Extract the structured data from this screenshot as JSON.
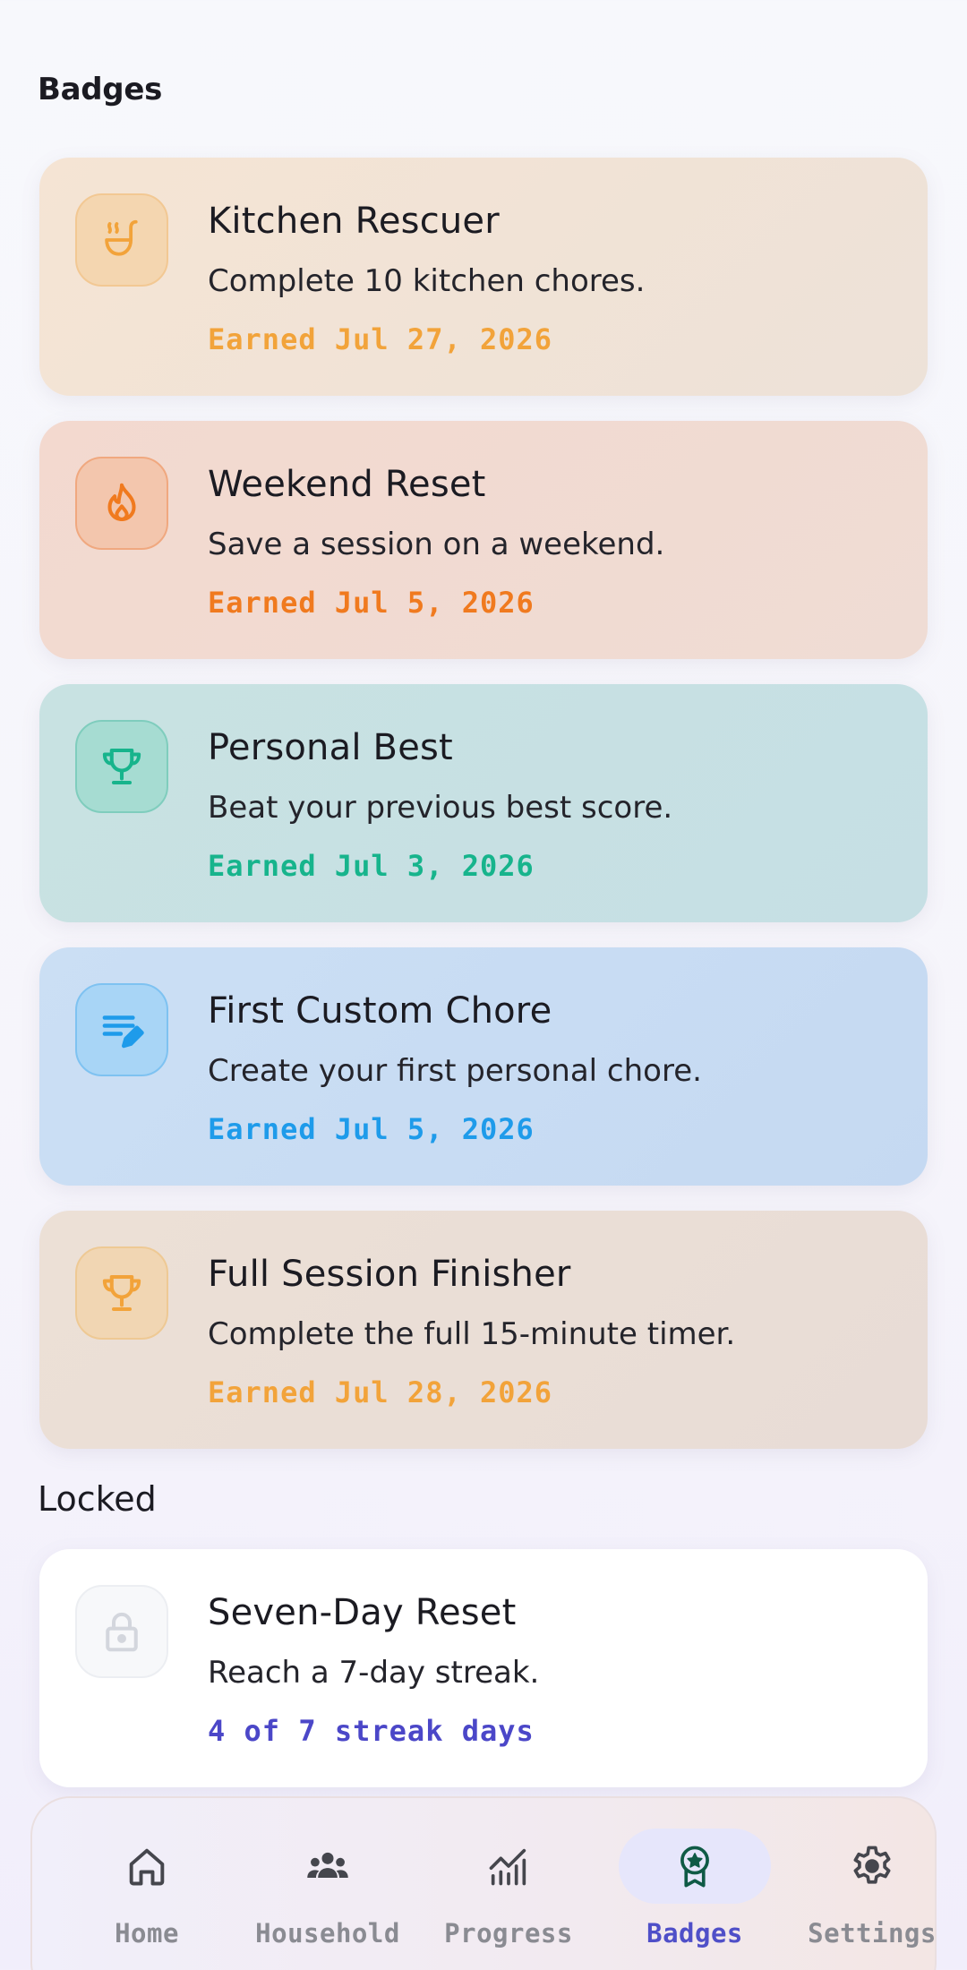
{
  "page": {
    "title": "Badges"
  },
  "earned": [
    {
      "title": "Kitchen Rescuer",
      "description": "Complete 10 kitchen chores.",
      "meta": "Earned Jul 27, 2026",
      "icon": "ladle-steam-icon",
      "accent": "#f2a33a"
    },
    {
      "title": "Weekend Reset",
      "description": "Save a session on a weekend.",
      "meta": "Earned Jul 5, 2026",
      "icon": "flame-icon",
      "accent": "#f07a1f"
    },
    {
      "title": "Personal Best",
      "description": "Beat your previous best score.",
      "meta": "Earned Jul 3, 2026",
      "icon": "trophy-icon",
      "accent": "#17b48c"
    },
    {
      "title": "First Custom Chore",
      "description": "Create your first personal chore.",
      "meta": "Earned Jul 5, 2026",
      "icon": "edit-list-icon",
      "accent": "#1e9bea"
    },
    {
      "title": "Full Session Finisher",
      "description": "Complete the full 15-minute timer.",
      "meta": "Earned Jul 28, 2026",
      "icon": "trophy-icon",
      "accent": "#f2a33a"
    }
  ],
  "locked_section": {
    "title": "Locked"
  },
  "locked": [
    {
      "title": "Seven-Day Reset",
      "description": "Reach a 7-day streak.",
      "meta": "4 of 7 streak days",
      "icon": "lock-icon",
      "accent": "#4b47c8"
    }
  ],
  "nav": {
    "items": [
      {
        "label": "Home",
        "icon": "home-icon"
      },
      {
        "label": "Household",
        "icon": "people-icon"
      },
      {
        "label": "Progress",
        "icon": "chart-icon"
      },
      {
        "label": "Badges",
        "icon": "badge-icon",
        "active": true
      },
      {
        "label": "Settings",
        "icon": "gear-icon"
      }
    ]
  },
  "colors": {
    "active_nav": "#4f4fc8",
    "inactive_nav": "#8a8b92",
    "badge_icon_active": "#0f5a45"
  }
}
